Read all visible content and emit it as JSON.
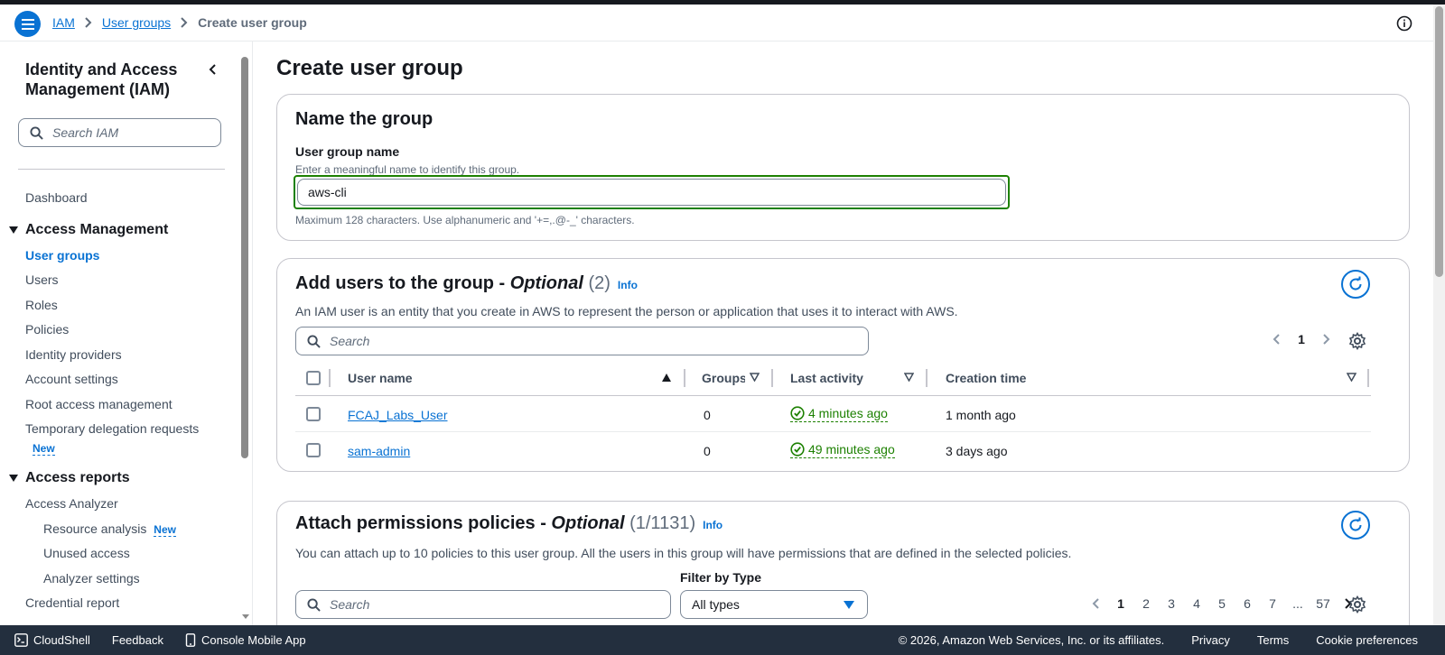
{
  "breadcrumb": {
    "items": [
      "IAM",
      "User groups"
    ],
    "current": "Create user group"
  },
  "sidebar": {
    "title": "Identity and Access Management (IAM)",
    "search_placeholder": "Search IAM",
    "dashboard": "Dashboard",
    "section_access_management": "Access Management",
    "items": [
      "User groups",
      "Users",
      "Roles",
      "Policies",
      "Identity providers",
      "Account settings",
      "Root access management",
      "Temporary delegation requests"
    ],
    "new_badge": "New",
    "section_access_reports": "Access reports",
    "access_analyzer": "Access Analyzer",
    "sub_items": [
      "Resource analysis",
      "Unused access",
      "Analyzer settings"
    ],
    "credential_report": "Credential report"
  },
  "main": {
    "page_title": "Create user group",
    "name_section": {
      "title": "Name the group",
      "label": "User group name",
      "description": "Enter a meaningful name to identify this group.",
      "value": "aws-cli",
      "hint": "Maximum 128 characters. Use alphanumeric and '+=,.@-_' characters."
    },
    "users_section": {
      "title": "Add users to the group - ",
      "optional": "Optional",
      "count": "(2)",
      "info": "Info",
      "description": "An IAM user is an entity that you create in AWS to represent the person or application that uses it to interact with AWS.",
      "search_placeholder": "Search",
      "page": "1",
      "columns": [
        "User name",
        "Groups",
        "Last activity",
        "Creation time"
      ],
      "rows": [
        {
          "name": "FCAJ_Labs_User",
          "groups": "0",
          "last_activity": "4 minutes ago",
          "created": "1 month ago"
        },
        {
          "name": "sam-admin",
          "groups": "0",
          "last_activity": "49 minutes ago",
          "created": "3 days ago"
        }
      ]
    },
    "policies_section": {
      "title": "Attach permissions policies - ",
      "optional": "Optional",
      "count": "(1/1131)",
      "info": "Info",
      "description": "You can attach up to 10 policies to this user group. All the users in this group will have permissions that are defined in the selected policies.",
      "search_placeholder": "Search",
      "filter_label": "Filter by Type",
      "filter_value": "All types",
      "pages": [
        "1",
        "2",
        "3",
        "4",
        "5",
        "6",
        "7",
        "...",
        "57"
      ]
    }
  },
  "footer": {
    "cloudshell": "CloudShell",
    "feedback": "Feedback",
    "mobile_app": "Console Mobile App",
    "copyright": "© 2026, Amazon Web Services, Inc. or its affiliates.",
    "privacy": "Privacy",
    "terms": "Terms",
    "cookies": "Cookie preferences"
  },
  "colors": {
    "accent": "#0972d3",
    "success": "#1d8102",
    "footer_bg": "#232f3e"
  }
}
